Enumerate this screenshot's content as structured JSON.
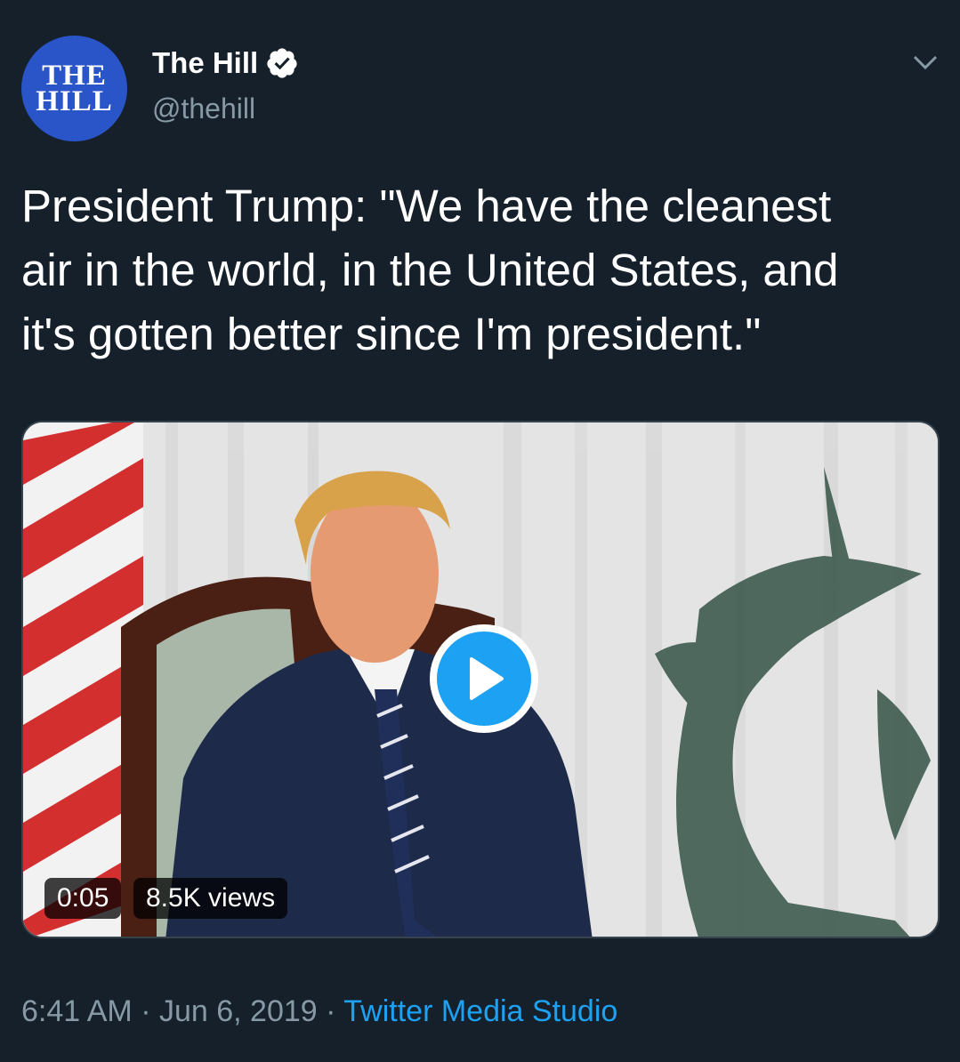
{
  "account": {
    "avatar_line1": "THE",
    "avatar_line2": "HILL",
    "display_name": "The Hill",
    "verified": true,
    "handle": "@thehill"
  },
  "tweet": {
    "text": "President Trump: \"We have the cleanest\nair in the world, in the United States, and\nit's gotten better since I'm president.\""
  },
  "media": {
    "type": "video",
    "duration": "0:05",
    "views": "8.5K views"
  },
  "meta": {
    "time": "6:41 AM",
    "separator1": " · ",
    "date": "Jun 6, 2019",
    "separator2": " · ",
    "source": "Twitter Media Studio"
  },
  "icons": {
    "verified": "verified-badge-icon",
    "menu": "chevron-down-icon",
    "play": "play-icon"
  },
  "colors": {
    "background": "#15202b",
    "accent": "#1da1f2",
    "secondary_text": "#8899a6",
    "avatar_bg": "#2a55c8"
  }
}
